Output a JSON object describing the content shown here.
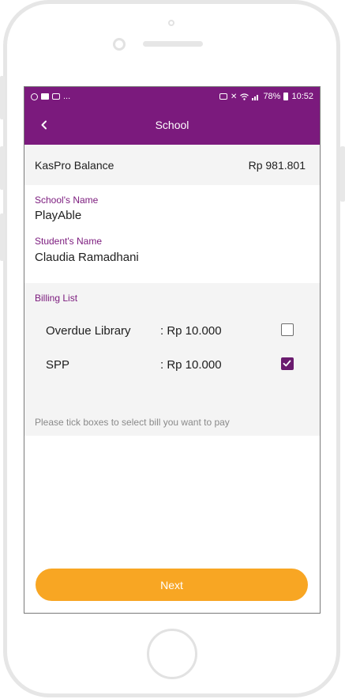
{
  "status_bar": {
    "left_more": "...",
    "battery": "78%",
    "time": "10:52",
    "icons": [
      "whatsapp-icon",
      "video-icon",
      "mail-icon",
      "cast-icon",
      "mute-icon",
      "wifi-icon",
      "signal-icon",
      "battery-icon"
    ]
  },
  "app_bar": {
    "title": "School",
    "back_icon": "back-chevron-icon"
  },
  "balance": {
    "label": "KasPro Balance",
    "amount": "Rp 981.801"
  },
  "school": {
    "label": "School's Name",
    "value": "PlayAble"
  },
  "student": {
    "label": "Student's Name",
    "value": "Claudia Ramadhani"
  },
  "billing": {
    "title": "Billing List",
    "items": [
      {
        "name": "Overdue Library",
        "amount": ": Rp 10.000",
        "checked": false
      },
      {
        "name": "SPP",
        "amount": ": Rp 10.000",
        "checked": true
      }
    ],
    "hint": "Please tick boxes to select bill you want to pay"
  },
  "next_button": {
    "label": "Next"
  },
  "colors": {
    "primary": "#7b1a7d",
    "accent": "#f8a623",
    "checkbox_checked": "#6a1b6e"
  }
}
